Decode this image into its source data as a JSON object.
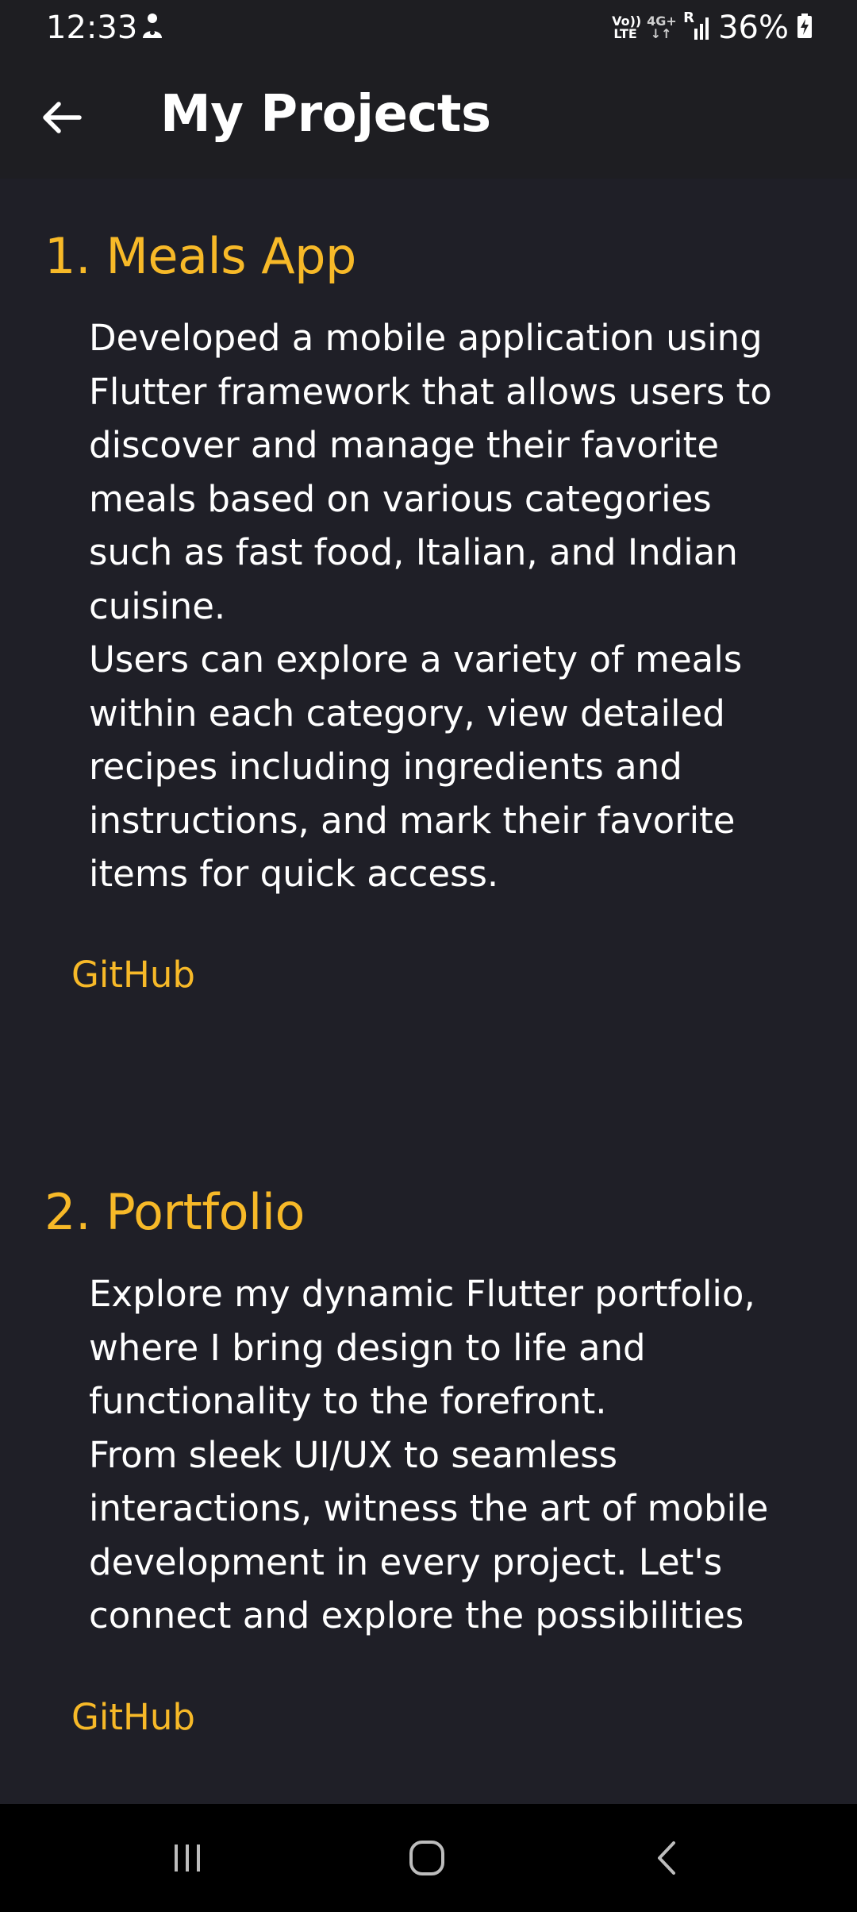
{
  "status_bar": {
    "time": "12:33",
    "network_top": "Vo))",
    "network_bottom": "LTE",
    "data_top": "4G+",
    "data_bottom": "↓↑",
    "signal_label": "R",
    "battery": "36%",
    "icons": [
      "notification-person-icon",
      "signal-icon",
      "battery-charging-icon"
    ]
  },
  "app_bar": {
    "title": "My Projects",
    "back_icon": "arrow-left-icon"
  },
  "projects": [
    {
      "title": "1. Meals App",
      "description": "Developed a mobile application using Flutter framework that allows users to discover and manage their favorite meals  based on various categories such as fast food, Italian, and Indian cuisine.\nUsers can explore a variety of meals within each category, view detailed recipes including ingredients and instructions, and mark their favorite items for quick access.",
      "link_label": "GitHub"
    },
    {
      "title": "2. Portfolio",
      "description": "Explore my dynamic Flutter portfolio, where I bring design to life and functionality to the forefront.\nFrom sleek UI/UX to seamless interactions, witness the art of mobile development in every project. Let's connect and explore the possibilities",
      "link_label": "GitHub"
    }
  ],
  "nav_bar": {
    "icons": [
      "recent-apps-icon",
      "home-icon",
      "back-icon"
    ]
  },
  "colors": {
    "accent": "#f7b928",
    "background": "#1f1f27",
    "app_bar": "#1e1e22",
    "text": "#ffffff"
  }
}
